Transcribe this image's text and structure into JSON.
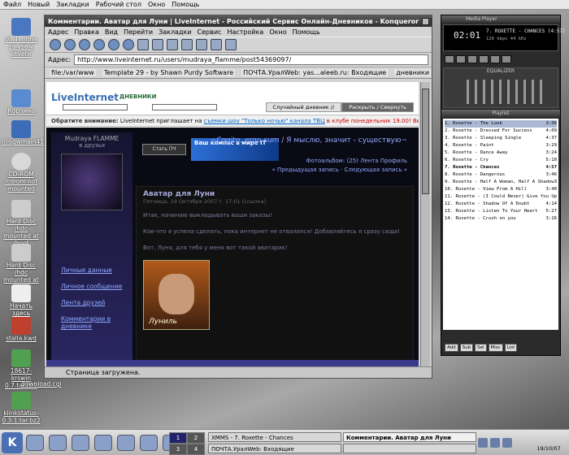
{
  "top_menu": [
    "Файл",
    "Новый",
    "Закладки",
    "Рабочий стол",
    "Окно",
    "Помощь"
  ],
  "desktop_icons": [
    {
      "label": "03 Ti odna za vse v otvete",
      "icon": "folder-icon"
    },
    {
      "label": "Корзина",
      "icon": "trash-icon"
    },
    {
      "label": "nilsgwmain41",
      "icon": "globe-icon"
    },
    {
      "label": "CD-ROM /cdrom not mounted",
      "icon": "cdrom-icon"
    },
    {
      "label": "Hard Disc /hdc mounted at /boot",
      "icon": "harddisk-icon"
    },
    {
      "label": "Hard Disc /hdc mounted at /",
      "icon": "harddisk-icon"
    },
    {
      "label": "Начать здесь",
      "icon": "document-icon"
    },
    {
      "label": "stalla.kwd",
      "icon": "kword-icon"
    },
    {
      "label": "18617-krswin 0.7.tar.bz2",
      "icon": "archive-icon"
    },
    {
      "label": "download.cgi",
      "icon": "cgi-icon"
    },
    {
      "label": "klinkstatus-0.3.1.tar.bz2",
      "icon": "archive-icon"
    }
  ],
  "konqueror": {
    "title": "Комментарии. Аватар для Луни | LiveInternet - Российский Сервис Онлайн-Дневников - Konqueror",
    "menu": [
      "Адрес",
      "Правка",
      "Вид",
      "Перейти",
      "Закладки",
      "Сервис",
      "Настройка",
      "Окно",
      "Помощь"
    ],
    "address_label": "Адрес:",
    "url": "http://www.liveinternet.ru/users/mudraya_flamme/post54369097/",
    "bookmarks": [
      "file:/var/www",
      "Template 29 - by Shawn Purdy Software",
      "ПОЧТА.УралWeb: yas...aleeb.ru: Входящие",
      "дневники"
    ],
    "status": "Страница загружена."
  },
  "page": {
    "logo": "LiveInternet",
    "diaries": "ДНЕВНИКИ",
    "tabs": [
      "Случайный дневник //",
      "Раскрыть / Свернуть"
    ],
    "notice_prefix": "Обратите внимание:",
    "notice_text": "LiveInternet приглашает на",
    "notice_link": "съемки шоу \"Только ночью\" канала ТВЦ",
    "notice_suffix": "в клубе понедельник 19.00! Выступает \"ЧАЙФ\"",
    "author": "Mudraya FLAMME",
    "friends": "в друзья",
    "subscribe": "Стать ПЧ",
    "banner": "Ваш компас в мире IT",
    "quote": "~Cogito, ergo sum / Я мыслю, значит - существую~",
    "meta_line1": "Фотоальбом: (25) Лента Профиль",
    "meta_line2": "« Предыдущая запись · Следующая запись »",
    "side_links": [
      "Личные данные",
      "Личное сообщение",
      "Лента друзей",
      "Комментарии в дневнике"
    ],
    "post_title": "Аватар для Луни",
    "post_date": "Пятница, 19 Октября 2007 г. 17:01 (ссылка)",
    "post_text": [
      "Итак, начинаю выкладывать ваши заказы!",
      "Кое-что я успела сделать, пока интернет не отвалился! Добавляйтесь я сразу сюда!",
      "Вот, Луня, для тебя у меня вот такой аватарик!"
    ],
    "post_img_signature": "Луниль"
  },
  "xmms": {
    "title": "Media Player",
    "time": "02:01",
    "song": "7. ROXETTE - CHANCES (4:57)",
    "rate": "128 kbps 44 kHz",
    "eq_title": "EQUALIZER",
    "playlist_title": "Playlist",
    "playlist": [
      {
        "title": "1. Roxette - The Look",
        "time": "3:56"
      },
      {
        "title": "2. Roxette - Dressed For Success",
        "time": "4:09"
      },
      {
        "title": "3. Roxette - Sleeping Single",
        "time": "4:37"
      },
      {
        "title": "4. Roxette - Paint",
        "time": "3:29"
      },
      {
        "title": "5. Roxette - Dance Away",
        "time": "3:24"
      },
      {
        "title": "6. Roxette - Cry",
        "time": "5:10"
      },
      {
        "title": "7. Roxette - Chances",
        "time": "4:57"
      },
      {
        "title": "8. Roxette - Dangerous",
        "time": "3:46"
      },
      {
        "title": "9. Roxette - Half A Woman, Half A Shadow",
        "time": "3:34"
      },
      {
        "title": "10. Roxette - View From A Hill",
        "time": "3:40"
      },
      {
        "title": "11. Roxette - (I Could Never) Give You Up",
        "time": "3:57"
      },
      {
        "title": "12. Roxette - Shadow Of A Doubt",
        "time": "4:14"
      },
      {
        "title": "13. Roxette - Listen To Your Heart",
        "time": "5:27"
      },
      {
        "title": "14. Roxette - Crush on you",
        "time": "3:16"
      }
    ],
    "playlist_buttons": [
      "Add",
      "Sub",
      "Sel",
      "Misc",
      "List"
    ]
  },
  "taskbar": {
    "kmenu": "K",
    "pager": [
      "1",
      "2",
      "3",
      "4"
    ],
    "tasks": [
      "XMMS - 7. Roxette - Chances",
      "Комментарии. Аватар для Луни",
      "ПОЧТА.УралWeb: Входящие",
      ""
    ],
    "lang": "EN",
    "clock": "19/10/07"
  }
}
